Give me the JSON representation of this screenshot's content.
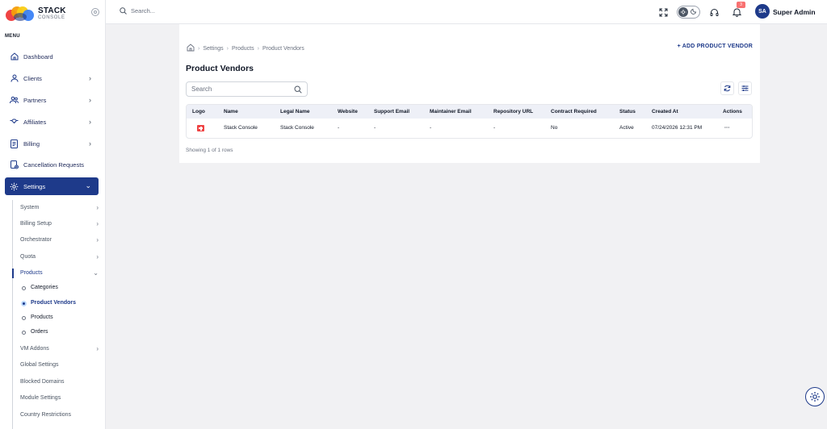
{
  "brand": {
    "name": "STACK",
    "sub": "CONSOLE"
  },
  "sidebar": {
    "menu_label": "MENU",
    "items": [
      {
        "label": "Dashboard",
        "icon": "home-icon"
      },
      {
        "label": "Clients",
        "icon": "user-icon"
      },
      {
        "label": "Partners",
        "icon": "users-icon"
      },
      {
        "label": "Affiliates",
        "icon": "handshake-icon"
      },
      {
        "label": "Billing",
        "icon": "document-icon"
      },
      {
        "label": "Cancellation Requests",
        "icon": "cancel-document-icon"
      },
      {
        "label": "Settings",
        "icon": "gear-icon"
      }
    ],
    "settings_sub": [
      {
        "label": "System"
      },
      {
        "label": "Billing Setup"
      },
      {
        "label": "Orchestrator"
      },
      {
        "label": "Quota"
      },
      {
        "label": "Products"
      }
    ],
    "products_sub": [
      {
        "label": "Categories"
      },
      {
        "label": "Product Vendors"
      },
      {
        "label": "Products"
      },
      {
        "label": "Orders"
      }
    ],
    "settings_sub_after": [
      {
        "label": "VM Addons"
      },
      {
        "label": "Global Settings"
      },
      {
        "label": "Blocked Domains"
      },
      {
        "label": "Module Settings"
      },
      {
        "label": "Country Restrictions"
      }
    ]
  },
  "topbar": {
    "search_placeholder": "Search...",
    "notification_count": "3",
    "avatar_initials": "SA",
    "user_name": "Super Admin"
  },
  "main": {
    "breadcrumb": [
      "Settings",
      "Products",
      "Product Vendors"
    ],
    "add_button": "+ ADD PRODUCT VENDOR",
    "title": "Product Vendors",
    "search_placeholder": "Search",
    "columns": [
      "Logo",
      "Name",
      "Legal Name",
      "Website",
      "Support Email",
      "Maintainer Email",
      "Repository URL",
      "Contract Required",
      "Status",
      "Created At",
      "Actions"
    ],
    "rows": [
      {
        "name": "Stack Console",
        "legal_name": "Stack Console",
        "website": "-",
        "support_email": "-",
        "maintainer_email": "-",
        "repository_url": "-",
        "contract_required": "No",
        "status": "Active",
        "created_at": "07/24/2026 12:31 PM",
        "actions": "···"
      }
    ],
    "showing": "Showing 1 of 1 rows"
  },
  "colors": {
    "primary": "#1e3a8a",
    "badge": "#f87171",
    "background": "#f1f1f3"
  }
}
